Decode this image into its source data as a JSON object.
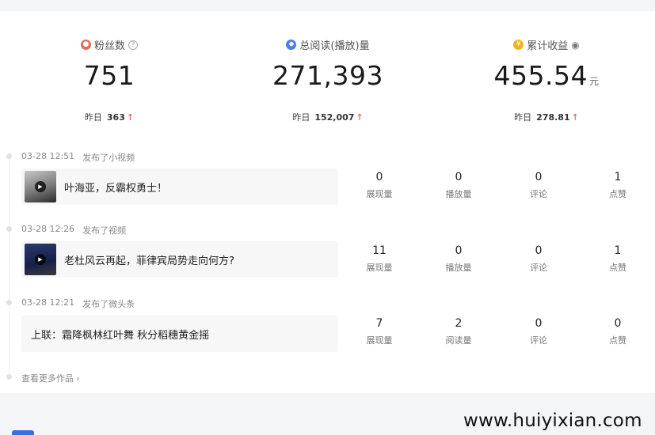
{
  "stats": [
    {
      "label": "粉丝数",
      "value": "751",
      "unit": "",
      "yesterday_label": "昨日",
      "yesterday_value": "363",
      "icon": "user-icon"
    },
    {
      "label": "总阅读(播放)量",
      "value": "271,393",
      "unit": "",
      "yesterday_label": "昨日",
      "yesterday_value": "152,007",
      "icon": "read-icon"
    },
    {
      "label": "累计收益",
      "value": "455.54",
      "unit": "元",
      "yesterday_label": "昨日",
      "yesterday_value": "278.81",
      "icon": "coin-icon"
    }
  ],
  "posts": [
    {
      "time": "03-28 12:51",
      "action": "发布了小视频",
      "title": "叶海亚，反霸权勇士！",
      "metrics": [
        {
          "value": "0",
          "label": "展现量"
        },
        {
          "value": "0",
          "label": "播放量"
        },
        {
          "value": "0",
          "label": "评论"
        },
        {
          "value": "1",
          "label": "点赞"
        }
      ]
    },
    {
      "time": "03-28 12:26",
      "action": "发布了视频",
      "title": "老杜风云再起，菲律宾局势走向何方?",
      "metrics": [
        {
          "value": "11",
          "label": "展现量"
        },
        {
          "value": "0",
          "label": "播放量"
        },
        {
          "value": "0",
          "label": "评论"
        },
        {
          "value": "1",
          "label": "点赞"
        }
      ]
    },
    {
      "time": "03-28 12:21",
      "action": "发布了微头条",
      "title": "上联：霜降枫林红叶舞 秋分稻穗黄金摇",
      "metrics": [
        {
          "value": "7",
          "label": "展现量"
        },
        {
          "value": "2",
          "label": "阅读量"
        },
        {
          "value": "0",
          "label": "评论"
        },
        {
          "value": "0",
          "label": "点赞"
        }
      ]
    }
  ],
  "more_link": "查看更多作品",
  "watermark": "www.huiyixian.com",
  "colors": {
    "up": "#e0443a",
    "accent": "#3a6fe0"
  }
}
